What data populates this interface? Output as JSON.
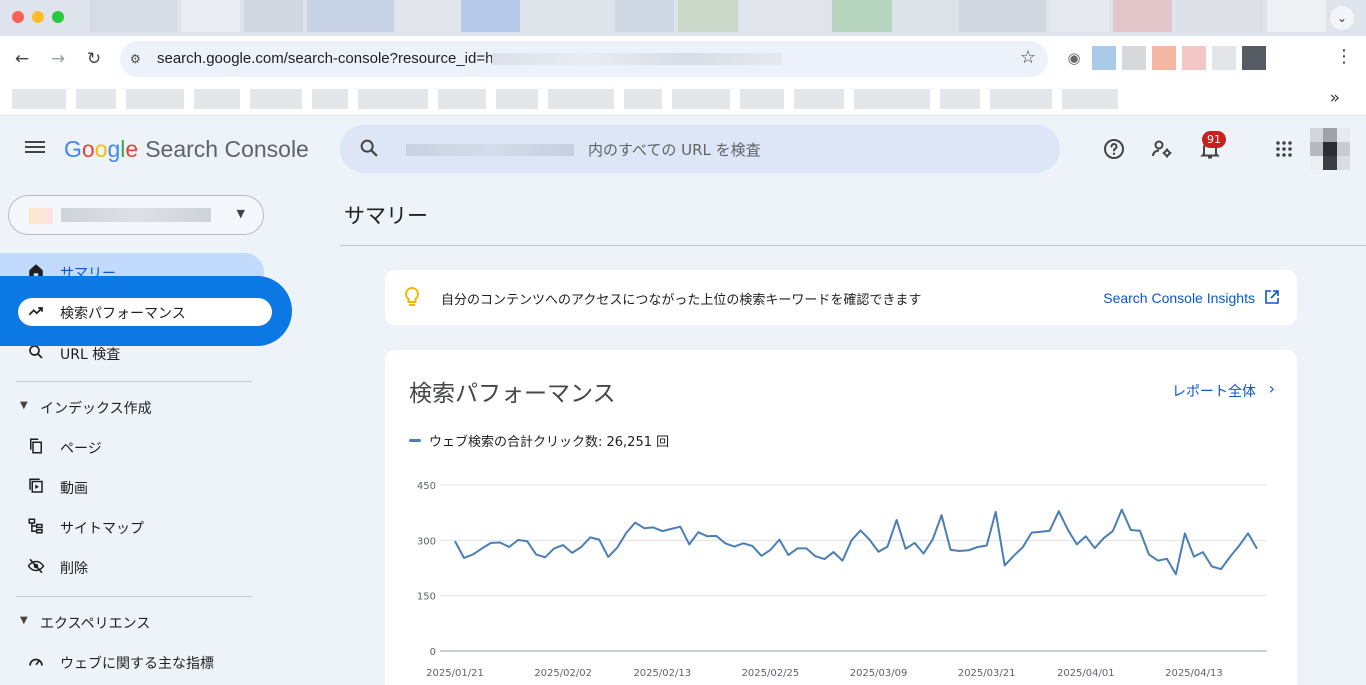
{
  "browser": {
    "url": "search.google.com/search-console?resource_id=h",
    "more_tabs_label": "»",
    "tab_colors": [
      "#d6dbe4",
      "#e9ecf1",
      "#d1d8e2",
      "#c7d2e6",
      "#e3e6ec",
      "#b7c9ea",
      "#dfe3ea",
      "#d0d8e6",
      "#c9d8c9",
      "#e2e6ec",
      "#b8d6bf",
      "#dde1e8",
      "#d2d7df",
      "#e6e9ee",
      "#e2c6ca",
      "#dcdfe5",
      "#eef0f3"
    ],
    "ext_colors": [
      "#a9cbe9",
      "#d6d8dc",
      "#f2b8a3",
      "#f3c7c6",
      "#e4e5e8",
      "#555a63"
    ],
    "bookmark_widths": [
      54,
      40,
      58,
      46,
      52,
      36,
      70,
      48,
      42,
      66,
      38,
      58,
      44,
      50,
      76,
      40,
      62,
      56
    ]
  },
  "header": {
    "logo_g": "G",
    "logo_o1": "o",
    "logo_o2": "o",
    "logo_g2": "g",
    "logo_l": "l",
    "logo_e": "e",
    "product_name": "Search Console",
    "search_placeholder": "内のすべての URL を検査",
    "notification_count": "91",
    "icons": [
      "help-icon",
      "manage-accounts-icon",
      "notifications-icon",
      "apps-icon"
    ],
    "avatar_colors": [
      "#d4d6da",
      "#9ea3aa",
      "#e9eaec",
      "#b6b9be",
      "#2b2e33",
      "#c9cbcf",
      "#eceef0",
      "#3b3e44",
      "#dadcdf"
    ]
  },
  "sidebar": {
    "summary": "サマリー",
    "performance": "検索パフォーマンス",
    "url_inspection": "URL 検査",
    "section_index": "インデックス作成",
    "pages": "ページ",
    "videos": "動画",
    "sitemaps": "サイトマップ",
    "removals": "削除",
    "section_experience": "エクスペリエンス",
    "core_web_vitals": "ウェブに関する主な指標"
  },
  "main": {
    "page_title": "サマリー",
    "insight_text": "自分のコンテンツへのアクセスにつながった上位の検索キーワードを確認できます",
    "insight_link": "Search Console Insights",
    "card_title": "検索パフォーマンス",
    "report_link": "レポート全体",
    "legend": "ウェブ検索の合計クリック数: 26,251 回"
  },
  "chart_data": {
    "type": "line",
    "title": "",
    "xlabel": "",
    "ylabel": "",
    "ylim": [
      0,
      450
    ],
    "yticks": [
      0,
      150,
      300,
      450
    ],
    "grid": true,
    "color": "#4a7fb5",
    "x_tick_labels": [
      "2025/01/21",
      "2025/02/02",
      "2025/02/13",
      "2025/02/25",
      "2025/03/09",
      "2025/03/21",
      "2025/04/01",
      "2025/04/13"
    ],
    "x_start": "2025/01/21",
    "x_end": "2025/04/19",
    "series": [
      {
        "name": "ウェブ検索の合計クリック数",
        "values": [
          298,
          252,
          262,
          278,
          293,
          294,
          282,
          301,
          298,
          262,
          254,
          278,
          287,
          266,
          282,
          308,
          302,
          255,
          280,
          320,
          348,
          333,
          335,
          325,
          331,
          337,
          289,
          322,
          311,
          312,
          292,
          283,
          292,
          285,
          258,
          274,
          302,
          260,
          278,
          278,
          257,
          249,
          268,
          245,
          300,
          327,
          302,
          269,
          283,
          355,
          277,
          293,
          264,
          302,
          368,
          274,
          271,
          273,
          282,
          286,
          377,
          232,
          258,
          281,
          321,
          323,
          326,
          379,
          329,
          289,
          311,
          279,
          306,
          325,
          383,
          328,
          326,
          262,
          245,
          250,
          208,
          319,
          256,
          268,
          229,
          222,
          255,
          285,
          319,
          277
        ]
      }
    ]
  }
}
